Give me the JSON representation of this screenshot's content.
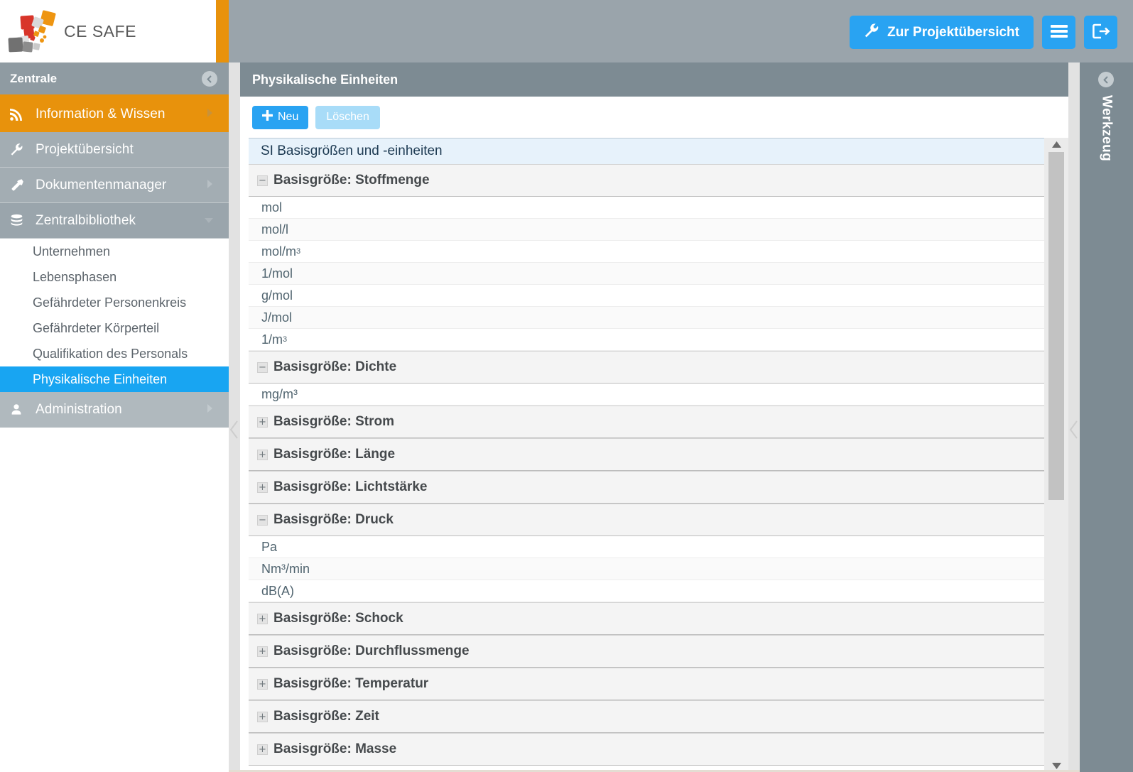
{
  "brand": {
    "name": "CE SAFE",
    "logo_icon": "ce-safe-squares-logo"
  },
  "sidebar": {
    "header": {
      "title": "Zentrale",
      "collapse_icon": "chevron-left-circle-icon"
    },
    "items": [
      {
        "label": "Information & Wissen",
        "icon": "rss-feed-icon",
        "state": "orange",
        "caret": true
      },
      {
        "label": "Projektübersicht",
        "icon": "wrench-icon",
        "state": "gray",
        "caret": false
      },
      {
        "label": "Dokumentenmanager",
        "icon": "hammer-icon",
        "state": "gray",
        "caret": true
      },
      {
        "label": "Zentralbibliothek",
        "icon": "database-icon",
        "state": "gray-dark",
        "caret": true
      }
    ],
    "sub_items": [
      {
        "label": "Unternehmen",
        "active": false
      },
      {
        "label": "Lebensphasen",
        "active": false
      },
      {
        "label": "Gefährdeter Personenkreis",
        "active": false
      },
      {
        "label": "Gefährdeter Körperteil",
        "active": false
      },
      {
        "label": "Qualifikation des Personals",
        "active": false
      },
      {
        "label": "Physikalische Einheiten",
        "active": true
      }
    ],
    "bottom_item": {
      "label": "Administration",
      "icon": "user-icon",
      "caret": true
    }
  },
  "topbar": {
    "overview_button": {
      "label": "Zur Projektübersicht",
      "icon": "wrench-icon"
    },
    "menu_button": {
      "icon": "hamburger-menu-icon"
    },
    "logout_button": {
      "icon": "logout-icon"
    },
    "accent_color": "#29a3f2"
  },
  "panel": {
    "title": "Physikalische Einheiten",
    "toolbar": {
      "new_label": "Neu",
      "new_icon": "plus-icon",
      "delete_label": "Löschen"
    },
    "section_title": "SI Basisgrößen und -einheiten",
    "groups": [
      {
        "label": "Basisgröße: Stoffmenge",
        "expanded": true,
        "toggle": "−",
        "units": [
          {
            "text": "mol",
            "base": "mol",
            "sup": ""
          },
          {
            "text": "mol/l",
            "base": "mol/l",
            "sup": ""
          },
          {
            "text": "mol/m3",
            "base": "mol/m",
            "sup": "3"
          },
          {
            "text": "1/mol",
            "base": "1/mol",
            "sup": ""
          },
          {
            "text": "g/mol",
            "base": "g/mol",
            "sup": ""
          },
          {
            "text": "J/mol",
            "base": "J/mol",
            "sup": ""
          },
          {
            "text": "1/m3",
            "base": "1/m",
            "sup": "3"
          }
        ]
      },
      {
        "label": "Basisgröße: Dichte",
        "expanded": true,
        "toggle": "−",
        "units": [
          {
            "text": "mg/m³",
            "base": "mg/m³",
            "sup": ""
          }
        ]
      },
      {
        "label": "Basisgröße: Strom",
        "expanded": false,
        "toggle": "+",
        "units": []
      },
      {
        "label": "Basisgröße: Länge",
        "expanded": false,
        "toggle": "+",
        "units": []
      },
      {
        "label": "Basisgröße: Lichtstärke",
        "expanded": false,
        "toggle": "+",
        "units": []
      },
      {
        "label": "Basisgröße: Druck",
        "expanded": true,
        "toggle": "−",
        "units": [
          {
            "text": "Pa",
            "base": "Pa",
            "sup": ""
          },
          {
            "text": "Nm³/min",
            "base": "Nm³/min",
            "sup": ""
          },
          {
            "text": "dB(A)",
            "base": "dB(A)",
            "sup": ""
          }
        ]
      },
      {
        "label": "Basisgröße: Schock",
        "expanded": false,
        "toggle": "+",
        "units": []
      },
      {
        "label": "Basisgröße: Durchflussmenge",
        "expanded": false,
        "toggle": "+",
        "units": []
      },
      {
        "label": "Basisgröße: Temperatur",
        "expanded": false,
        "toggle": "+",
        "units": []
      },
      {
        "label": "Basisgröße: Zeit",
        "expanded": false,
        "toggle": "+",
        "units": []
      },
      {
        "label": "Basisgröße: Masse",
        "expanded": false,
        "toggle": "+",
        "units": []
      }
    ]
  },
  "toolrail": {
    "label": "Werkzeug",
    "collapse_icon": "chevron-left-circle-icon"
  }
}
